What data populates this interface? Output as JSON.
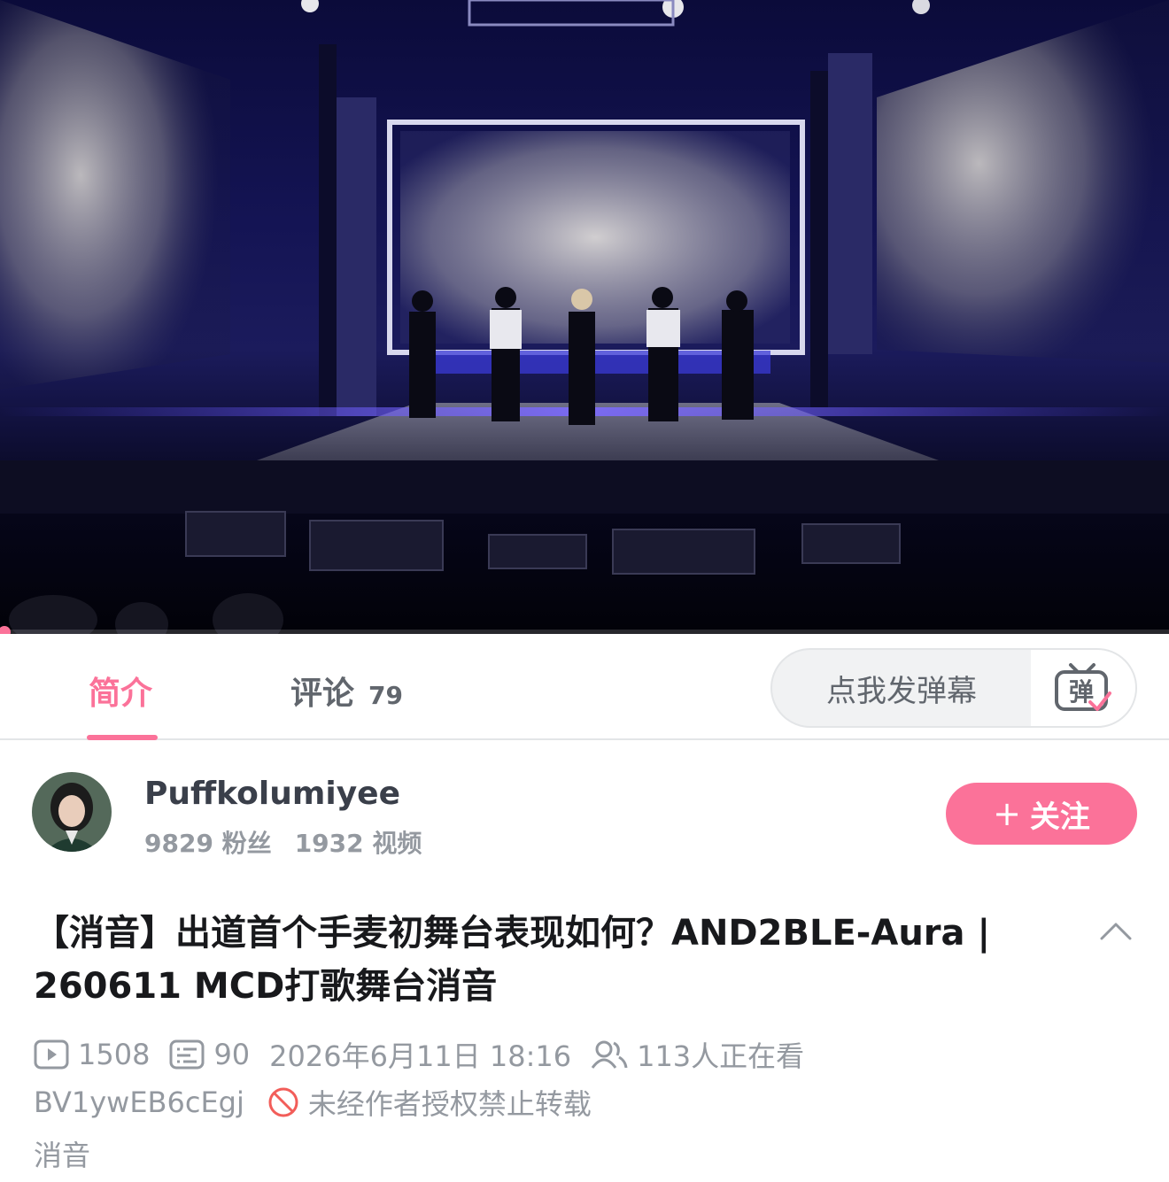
{
  "player": {
    "progress_fraction": 0.004
  },
  "tabs": {
    "intro_label": "简介",
    "comments_label": "评论",
    "comments_count": "79"
  },
  "danmaku": {
    "placeholder": "点我发弹幕",
    "button_glyph": "弹"
  },
  "uploader": {
    "name": "Puffkolumiyee",
    "followers": "9829 粉丝",
    "videos": "1932 视频",
    "follow_plus": "+",
    "follow_label": "关注"
  },
  "video": {
    "title": "【消音】出道首个手麦初舞台表现如何？AND2BLE-Aura | 260611 MCD打歌舞台消音",
    "views": "1508",
    "danmaku_count": "90",
    "publish_time": "2026年6月11日 18:16",
    "watching": "113人正在看",
    "bvid": "BV1ywEB6cEgj",
    "copyright_notice": "未经作者授权禁止转载",
    "tag": "消音"
  },
  "colors": {
    "brand_pink": "#fb7299",
    "text_gray": "#9499a0",
    "tab_gray": "#61666d"
  },
  "icons": [
    "danmaku-tv-icon",
    "play-count-icon",
    "danmaku-count-icon",
    "viewers-icon",
    "no-repost-icon",
    "chevron-up-icon",
    "plus-icon"
  ]
}
